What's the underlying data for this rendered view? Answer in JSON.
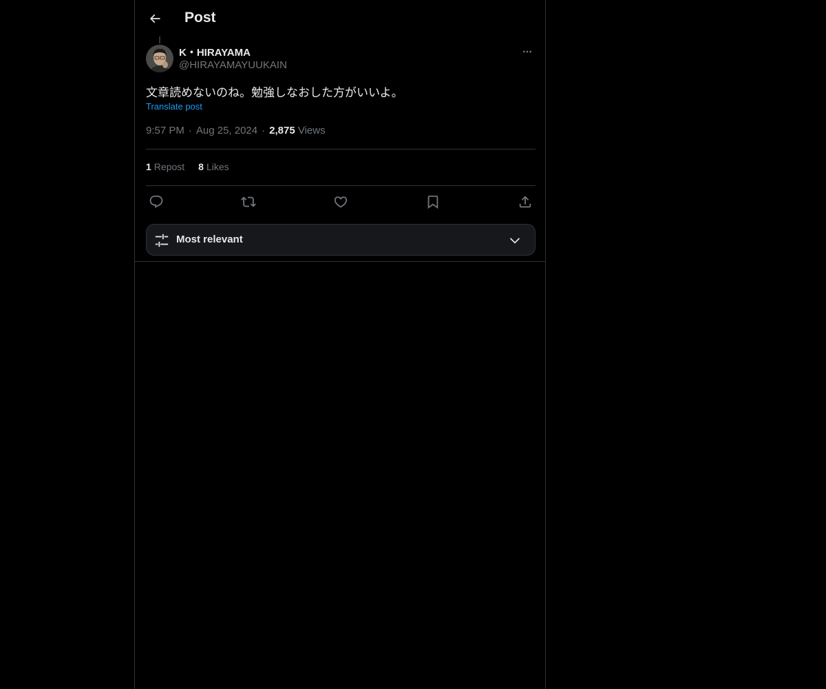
{
  "header": {
    "title": "Post",
    "back_icon": "arrow-left-icon"
  },
  "post": {
    "author_name": "K・HIRAYAMA",
    "author_handle": "@HIRAYAMAYUUKAIN",
    "text": "文章読めないのね。勉強しなおした方がいいよ。",
    "translate_label": "Translate post",
    "time": "9:57 PM",
    "date": "Aug 25, 2024",
    "views_count": "2,875",
    "views_label": "Views",
    "reposts_count": "1",
    "reposts_label": "Repost",
    "likes_count": "8",
    "likes_label": "Likes"
  },
  "actions": [
    {
      "name": "reply",
      "icon": "reply-icon"
    },
    {
      "name": "repost",
      "icon": "repost-icon"
    },
    {
      "name": "like",
      "icon": "heart-icon"
    },
    {
      "name": "bookmark",
      "icon": "bookmark-icon"
    },
    {
      "name": "share",
      "icon": "share-icon"
    }
  ],
  "sort": {
    "label": "Most relevant",
    "icon": "sliders-icon"
  },
  "colors": {
    "background": "#000000",
    "text_primary": "#e7e9ea",
    "text_secondary": "#71767b",
    "link": "#1d9bf0",
    "border": "#2f3336"
  }
}
